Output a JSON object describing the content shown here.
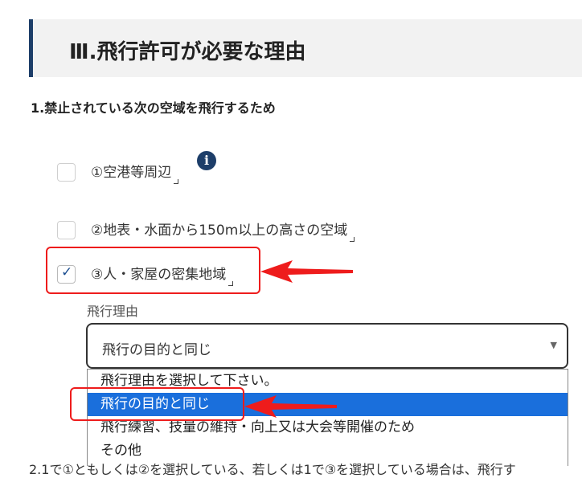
{
  "section": {
    "title": "Ⅲ.飛行許可が必要な理由"
  },
  "question": {
    "label": "1.禁止されている次の空域を飛行するため"
  },
  "options": [
    {
      "label": "①空港等周辺",
      "checked": false
    },
    {
      "label": "②地表・水面から150m以上の高さの空域",
      "checked": false
    },
    {
      "label": "③人・家屋の密集地域",
      "checked": true
    }
  ],
  "info_icon": {
    "icon": "info-icon",
    "symbol": "i"
  },
  "checkmark_symbol": "✓",
  "reason": {
    "label": "飛行理由",
    "selected_value": "飛行の目的と同じ",
    "caret": "▼",
    "dropdown_options": [
      "飛行理由を選択して下さい。",
      "飛行の目的と同じ",
      "飛行練習、技量の維持・向上又は大会等開催のため",
      "その他"
    ],
    "highlighted_index": 1
  },
  "cut_off_text": "2.1で①ともしくは②を選択している、若しくは1で③を選択している場合は、飛行す",
  "colors": {
    "header_accent": "#1d3e69",
    "annotation_red": "#ee1c1c",
    "dropdown_highlight": "#1a6fdc",
    "checkmark": "#1d4f91"
  }
}
